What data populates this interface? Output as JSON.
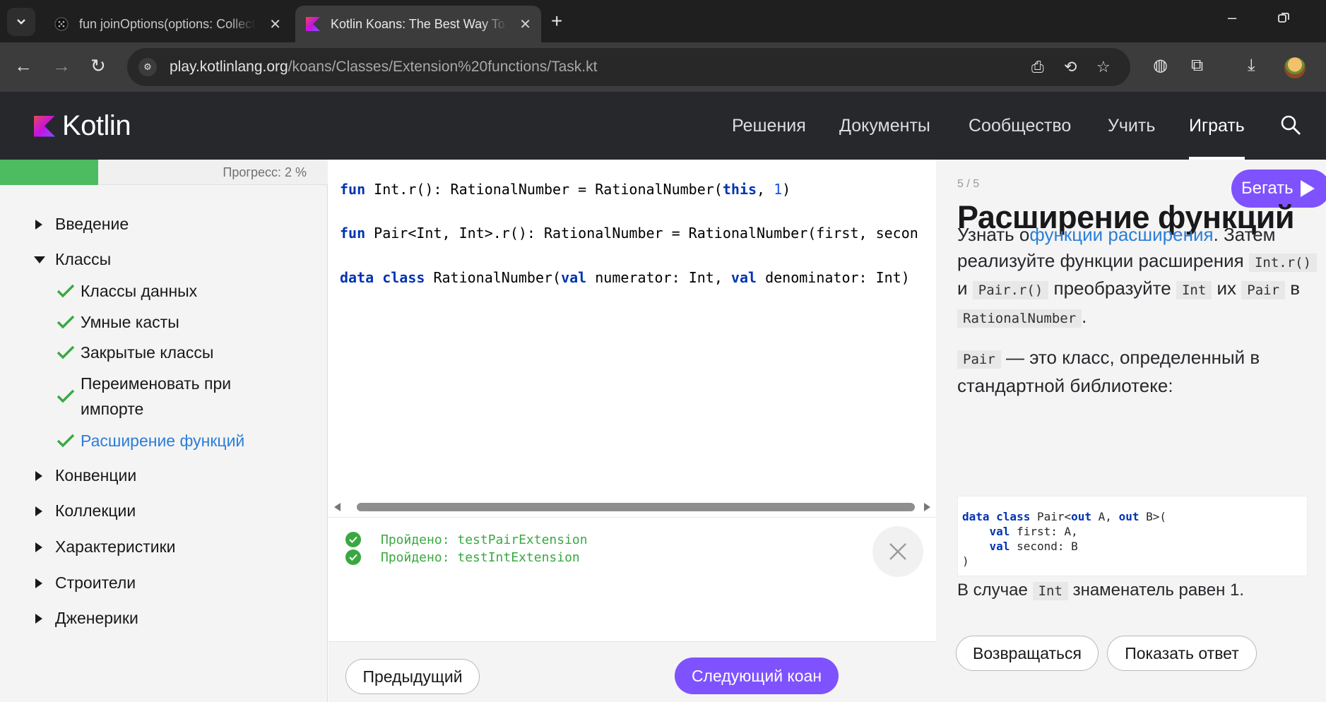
{
  "browser": {
    "tabs": [
      {
        "title": "fun joinOptions(options: Collect",
        "active": false
      },
      {
        "title": "Kotlin Koans: The Best Way To L",
        "active": true
      }
    ],
    "url_host": "play.kotlinlang.org",
    "url_path": "/koans/Classes/Extension%20functions/Task.kt"
  },
  "header": {
    "logo_text": "Kotlin",
    "nav": [
      {
        "label": "Решения"
      },
      {
        "label": "Документы"
      },
      {
        "label": "Сообщество"
      },
      {
        "label": "Учить"
      },
      {
        "label": "Играть",
        "active": true
      }
    ]
  },
  "sidebar": {
    "progress_percent": 2,
    "progress_label": "Прогресс: 2 %",
    "sections": [
      {
        "label": "Введение",
        "expanded": false
      },
      {
        "label": "Классы",
        "expanded": true,
        "items": [
          {
            "label": "Классы данных",
            "done": true
          },
          {
            "label": "Умные касты",
            "done": true
          },
          {
            "label": "Закрытые классы",
            "done": true
          },
          {
            "label": "Переименовать при",
            "label2": "импорте",
            "done": true
          },
          {
            "label": "Расширение функций",
            "done": true,
            "current": true
          }
        ]
      },
      {
        "label": "Конвенции",
        "expanded": false
      },
      {
        "label": "Коллекции",
        "expanded": false
      },
      {
        "label": "Характеристики",
        "expanded": false
      },
      {
        "label": "Строители",
        "expanded": false
      },
      {
        "label": "Дженерики",
        "expanded": false
      }
    ]
  },
  "editor": {
    "lines": [
      {
        "kw": "fun",
        "rest": " Int.r(): RationalNumber = RationalNumber(",
        "kw2": "this",
        "sep": ", ",
        "num": "1",
        "end": ")"
      },
      {
        "kw": "fun",
        "rest": " Pair<Int, Int>.r(): RationalNumber = RationalNumber(first, secon"
      },
      {
        "kw": "data class",
        "rest": " RationalNumber(",
        "kw2": "val",
        "mid": " numerator: Int, ",
        "kw3": "val",
        "end": " denominator: Int)"
      }
    ]
  },
  "results": [
    {
      "text": "Пройдено: testPairExtension"
    },
    {
      "text": "Пройдено: testIntExtension"
    }
  ],
  "buttons": {
    "previous": "Предыдущий",
    "next": "Следующий коан",
    "run": "Бегать",
    "back": "Возвращаться",
    "show_answer": "Показать ответ"
  },
  "task": {
    "counter": "5 / 5",
    "title": "Расширение функций",
    "p1_a": "Узнать о",
    "p1_link": "функции расширения",
    "p1_b": ". Затем реализуйте функции расширения",
    "code_int_r": "Int.r()",
    "p1_c": "и",
    "code_pair_r": "Pair.r()",
    "p1_d": "преобразуйте",
    "code_int": "Int",
    "p1_e": "их",
    "code_pair": "Pair",
    "p1_f": "в",
    "code_rational": "RationalNumber",
    "p1_g": ".",
    "p2_code": "Pair",
    "p2_text": "— это класс, определенный в стандартной библиотеке:",
    "code_block": {
      "l1_kw": "data class",
      "l1_rest": " Pair<",
      "l1_kw2": "out",
      "l1_mid": " A, ",
      "l1_kw3": "out",
      "l1_end": " B>(",
      "l2_kw": "val",
      "l2_rest": " first: A,",
      "l3_kw": "val",
      "l3_rest": " second: B",
      "l4": ")"
    },
    "p3_a": "В случае",
    "p3_code": "Int",
    "p3_b": "знаменатель равен 1."
  },
  "colors": {
    "accent": "#7f52ff",
    "success": "#3aa842",
    "progress": "#4dbb5f",
    "link": "#2b7ed8"
  }
}
